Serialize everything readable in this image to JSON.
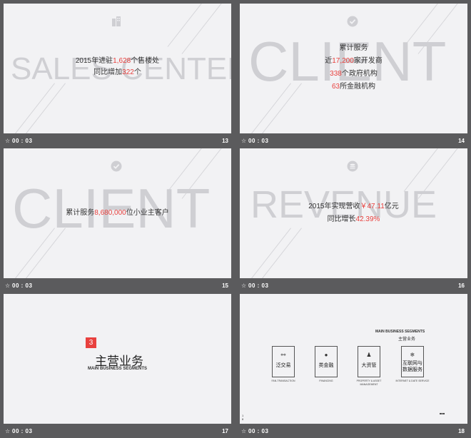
{
  "slides": [
    {
      "bg_word": "SALES CENTER",
      "line1_a": "2015年进驻",
      "line1_b": "1,628",
      "line1_c": "个售楼处",
      "line2_a": "同比增加",
      "line2_b": "322",
      "line2_c": "个",
      "icon": "building-icon",
      "time": "00 : 03",
      "number": "13"
    },
    {
      "bg_word": "CLIENT",
      "line1": "累计服务",
      "line2_a": "近",
      "line2_b": "17,200",
      "line2_c": "家开发商",
      "line3_a": "338",
      "line3_b": "个政府机构",
      "line4_a": "63",
      "line4_b": "所金融机构",
      "icon": "check-circle-icon",
      "time": "00 : 03",
      "number": "14"
    },
    {
      "bg_word": "CLIENT",
      "line1_a": "累计服务",
      "line1_b": "8,680,000",
      "line1_c": "位小业主客户",
      "icon": "check-circle-icon",
      "time": "00 : 03",
      "number": "15"
    },
    {
      "bg_word": "REVENUE",
      "line1_a": "2015年实现营收",
      "line1_b": "￥47.11",
      "line1_c": "亿元",
      "line2_a": "同比增长",
      "line2_b": "42.39%",
      "icon": "coins-icon",
      "time": "00 : 03",
      "number": "16"
    },
    {
      "section_number": "3",
      "title": "主营业务",
      "subtitle": "MAIN BUSINESS SEGMENTS",
      "time": "00 : 03",
      "number": "17"
    },
    {
      "header_en": "MAIN BUSINESS SEGMENTS",
      "header_cn": "主营业务",
      "segments": [
        {
          "label": "泛交易",
          "caption": "FAN-TRANSACTION",
          "icon": "link-icon"
        },
        {
          "label": "类金融",
          "caption": "FINANCING",
          "icon": "coin-icon"
        },
        {
          "label": "大资管",
          "caption": "PROPERTY & ASSET MANAGEMENT",
          "icon": "person-icon"
        },
        {
          "label": "互联网与数据服务",
          "caption": "INTERNET & DATE SERVICE",
          "icon": "snowflake-icon"
        }
      ],
      "footer_left": "1 8",
      "footer_right": "■■■",
      "time": "00 : 03",
      "number": "18"
    }
  ],
  "colors": {
    "accent": "#e8413e",
    "slide_bg": "#f2f2f4",
    "frame_bg": "#5b5b5d"
  }
}
